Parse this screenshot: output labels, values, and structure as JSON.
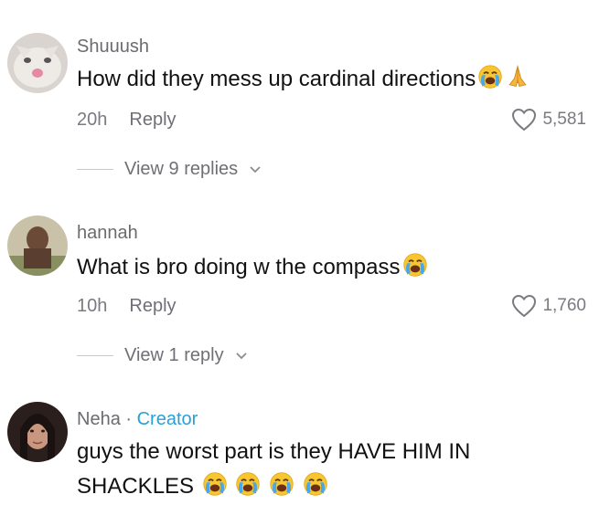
{
  "comments": [
    {
      "username": "Shuuush",
      "text": "How did they mess up cardinal directions",
      "time": "20h",
      "reply_label": "Reply",
      "likes": "5,581",
      "view_replies": "View 9 replies",
      "emojis": [
        "loudly-crying-face",
        "folded-hands"
      ]
    },
    {
      "username": "hannah",
      "text": "What is bro doing w the compass",
      "time": "10h",
      "reply_label": "Reply",
      "likes": "1,760",
      "view_replies": "View 1 reply",
      "emojis": [
        "loudly-crying-face"
      ]
    },
    {
      "username": "Neha",
      "creator_separator": "·",
      "creator_label": "Creator",
      "text_line1": "guys the worst part is they HAVE HIM IN",
      "text_line2": "SHACKLES",
      "emojis": [
        "loudly-crying-face",
        "loudly-crying-face",
        "loudly-crying-face",
        "loudly-crying-face"
      ]
    }
  ],
  "colors": {
    "creator": "#2a9fd8",
    "secondary_text": "#7a7a80",
    "primary_text": "#111111"
  }
}
